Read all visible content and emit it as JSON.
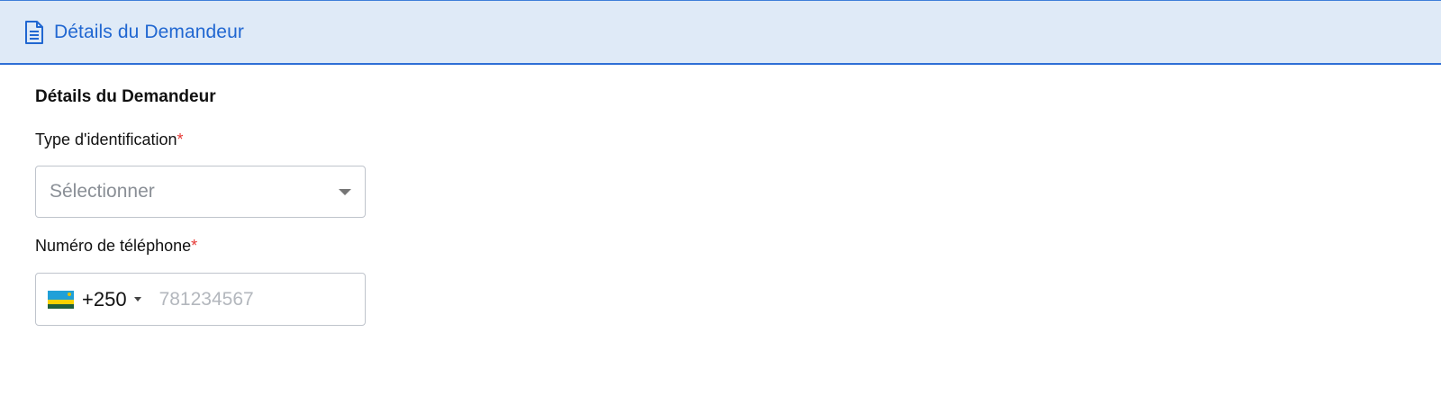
{
  "header": {
    "title": "Détails du Demandeur",
    "icon": "document-icon",
    "accent_color": "#2167d1",
    "background_color": "#dfeaf7"
  },
  "section": {
    "title": "Détails du Demandeur"
  },
  "id_type": {
    "label": "Type d'identification",
    "required_marker": "*",
    "placeholder": "Sélectionner",
    "icon": "chevron-down-icon"
  },
  "phone": {
    "label": "Numéro de téléphone",
    "required_marker": "*",
    "country_flag": "rwanda-flag-icon",
    "dial_code": "+250",
    "placeholder": "781234567",
    "value": ""
  },
  "colors": {
    "required": "#e53935",
    "border": "#bfc4cc"
  }
}
